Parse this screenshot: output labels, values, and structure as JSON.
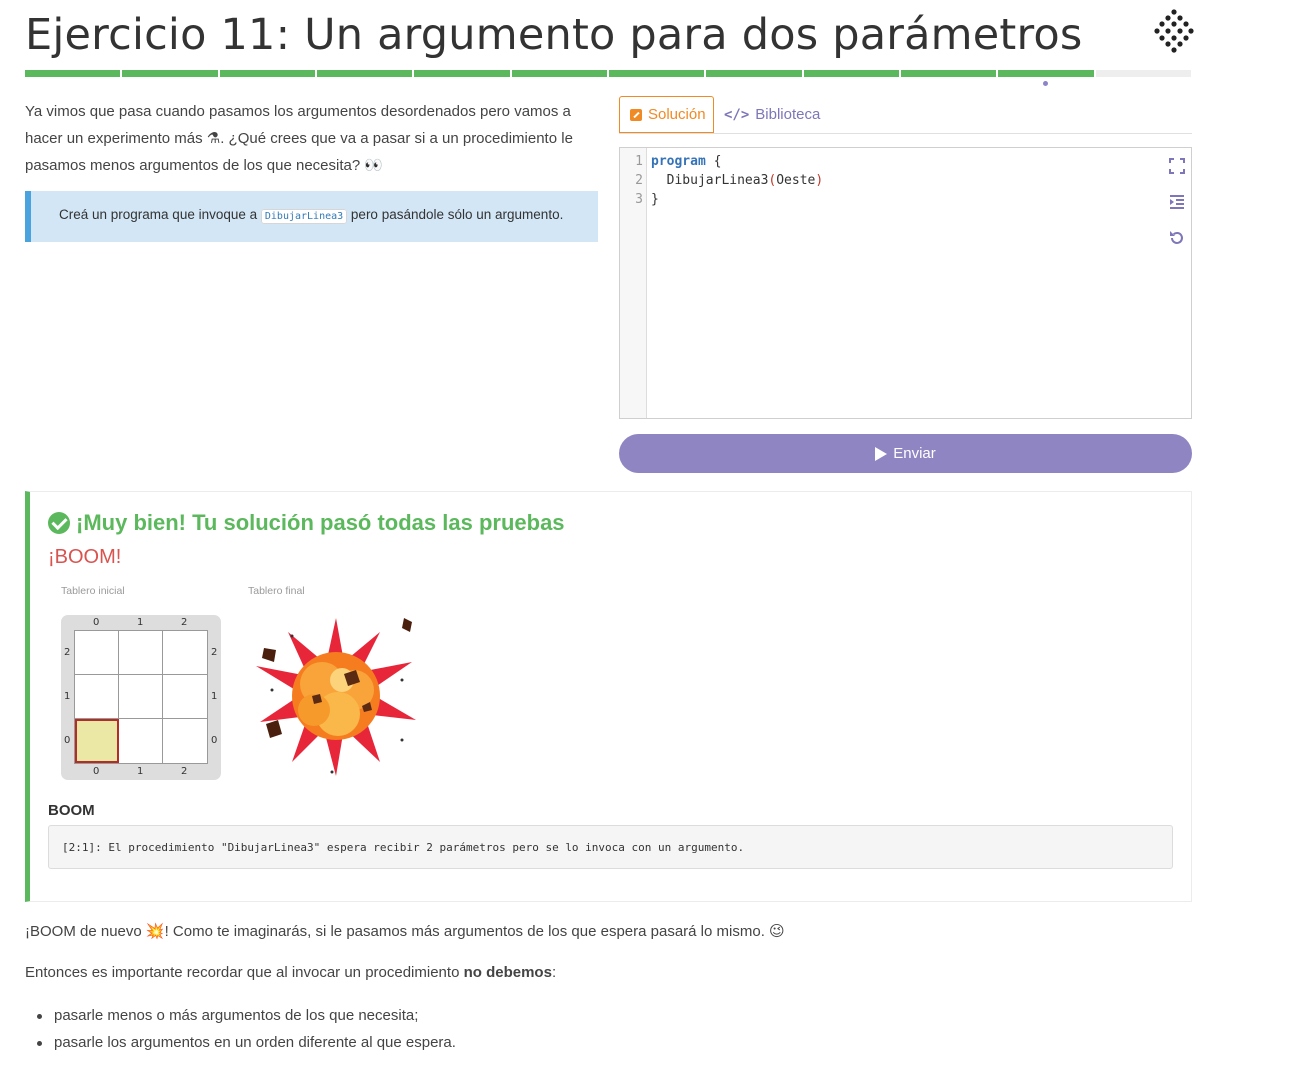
{
  "header": {
    "title": "Ejercicio 11: Un argumento para dos parámetros",
    "logo_icon": "diamond-dots-logo"
  },
  "progress": {
    "total_steps": 12,
    "completed_steps": 11,
    "done_color": "#5cb85c",
    "current_dot_color": "#8b84c8"
  },
  "intro": {
    "part1": "Ya vimos que pasa cuando pasamos los argumentos desordenados pero vamos a hacer un experimento más ",
    "emoji1": "⚗",
    "part2": ". ¿Qué crees que va a pasar si a un procedimiento le pasamos menos argumentos de los que necesita? ",
    "emoji2": "👀"
  },
  "task": {
    "text_before": "Creá un programa que invoque a ",
    "code": "DibujarLinea3",
    "text_after": " pero pasándole sólo un argumento."
  },
  "tabs": {
    "solution_label": "Solución",
    "library_label": "Biblioteca",
    "active_color": "#f08a24",
    "inactive_color": "#7d76b8"
  },
  "editor": {
    "line_numbers": [
      "1",
      "2",
      "3"
    ],
    "line1_keyword": "program",
    "line1_rest": " {",
    "line2_indent": "  ",
    "line2_name": "DibujarLinea3",
    "line2_open": "(",
    "line2_arg": "Oeste",
    "line2_close": ")",
    "line3": "}",
    "tools": [
      "fullscreen-icon",
      "indent-icon",
      "reset-icon"
    ]
  },
  "send_button": {
    "label": "Enviar",
    "color": "#8e85c2"
  },
  "result": {
    "title": "¡Muy bien! Tu solución pasó todas las pruebas",
    "subtitle": "¡BOOM!",
    "initial_board_label": "Tablero inicial",
    "final_board_label": "Tablero final",
    "board": {
      "columns": [
        "0",
        "1",
        "2"
      ],
      "rows": [
        "2",
        "1",
        "0"
      ],
      "head_cell": "0,0"
    },
    "error_title": "BOOM",
    "error_message": "[2:1]: El procedimiento \"DibujarLinea3\" espera recibir 2 parámetros pero se lo invoca con un argumento."
  },
  "after": {
    "p1_before": "¡BOOM de nuevo ",
    "p1_emoji": "💥",
    "p1_after": "! Como te imaginarás, si le pasamos más argumentos de los que espera pasará lo mismo. ",
    "p1_emoji2": "😉",
    "p2_before": "Entonces es importante recordar que al invocar un procedimiento ",
    "p2_bold": "no debemos",
    "p2_after": ":",
    "bullets": [
      "pasarle menos o más argumentos de los que necesita;",
      "pasarle los argumentos en un orden diferente al que espera."
    ]
  }
}
